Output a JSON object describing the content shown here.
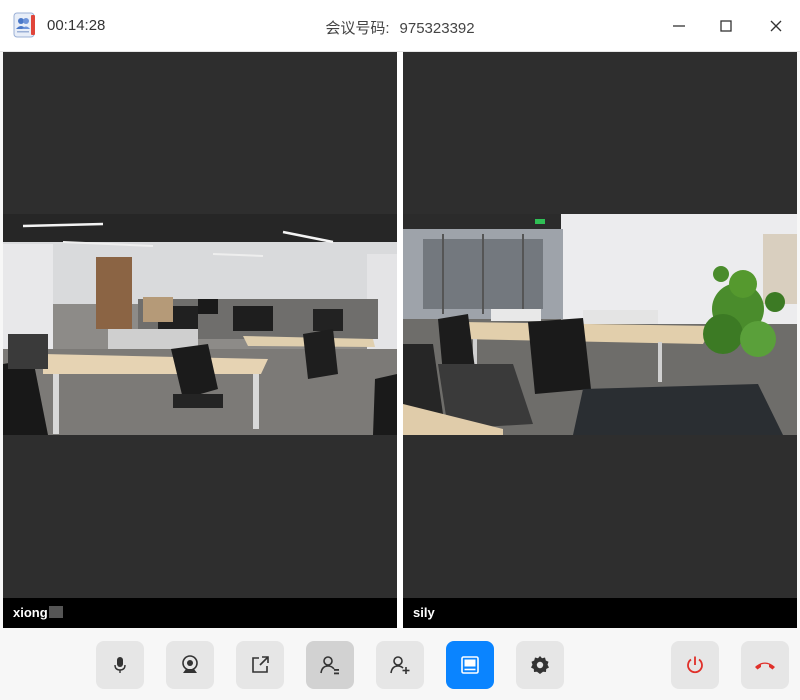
{
  "title_bar": {
    "timer": "00:14:28",
    "meeting_label": "会议号码:",
    "meeting_number": "975323392"
  },
  "participants": [
    {
      "name": "xiong"
    },
    {
      "name": "sily"
    }
  ],
  "toolbar": {
    "buttons": [
      {
        "icon": "microphone-icon"
      },
      {
        "icon": "camera-icon"
      },
      {
        "icon": "screen-share-icon"
      },
      {
        "icon": "participants-icon",
        "state": "pressed"
      },
      {
        "icon": "add-participant-icon"
      },
      {
        "icon": "layout-icon",
        "state": "active"
      },
      {
        "icon": "gear-icon"
      },
      {
        "icon": "power-icon"
      },
      {
        "icon": "hang-up-icon"
      }
    ]
  },
  "colors": {
    "accent": "#0a84ff",
    "danger": "#e0302a",
    "video_background": "#2e2e2e",
    "name_bar": "#000000"
  }
}
